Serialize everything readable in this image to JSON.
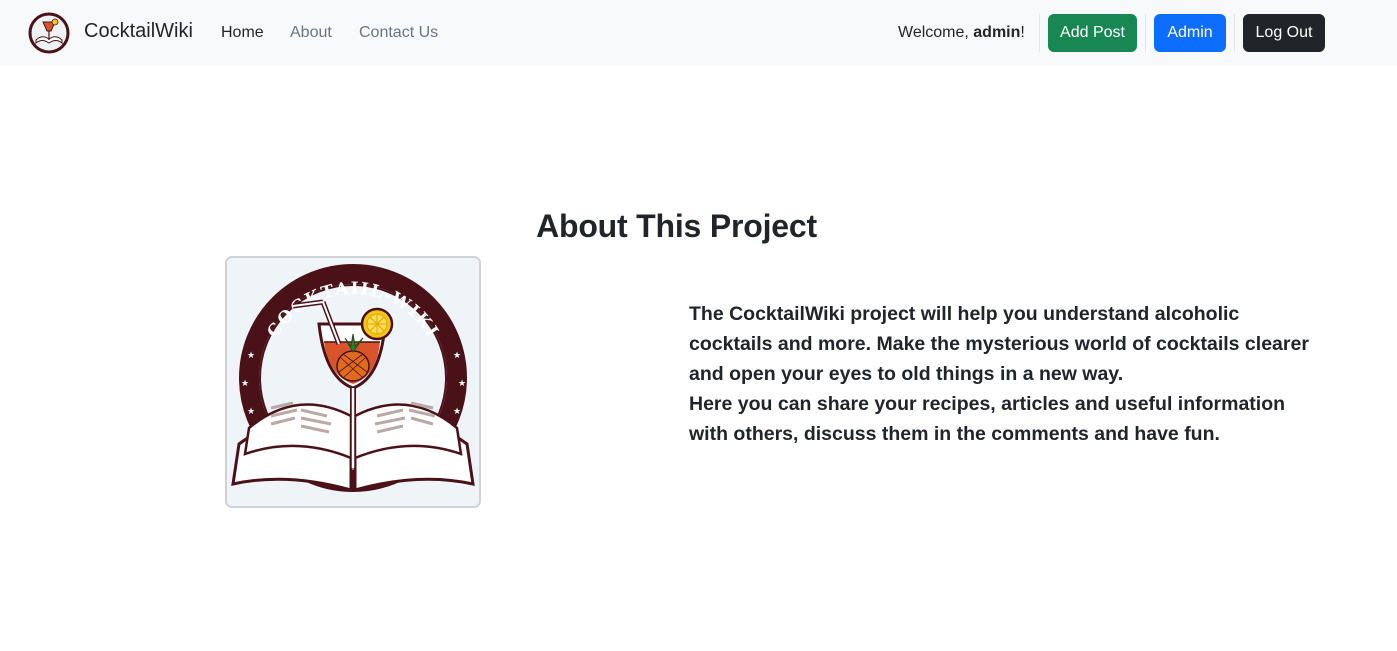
{
  "navbar": {
    "brand": "CocktailWiki",
    "links": [
      {
        "label": "Home",
        "active": true
      },
      {
        "label": "About",
        "active": false
      },
      {
        "label": "Contact Us",
        "active": false
      }
    ],
    "welcome_prefix": "Welcome, ",
    "username": "admin",
    "welcome_suffix": "!",
    "buttons": {
      "add_post": "Add Post",
      "admin": "Admin",
      "log_out": "Log Out"
    }
  },
  "main": {
    "title": "About This Project",
    "logo_text": "COCKTAIIL-WIKI",
    "paragraphs": [
      "The CocktailWiki project will help you understand alcoholic cocktails and more. Make the mysterious world of cocktails clearer and open your eyes to old things in a new way.",
      "Here you can share your recipes, articles and useful information with others, discuss them in the comments and have fun."
    ]
  },
  "colors": {
    "navbar_bg": "#f8f9fa",
    "add_post": "#198754",
    "admin": "#0d6efd",
    "log_out": "#212529",
    "logo_ring": "#4a1218"
  }
}
